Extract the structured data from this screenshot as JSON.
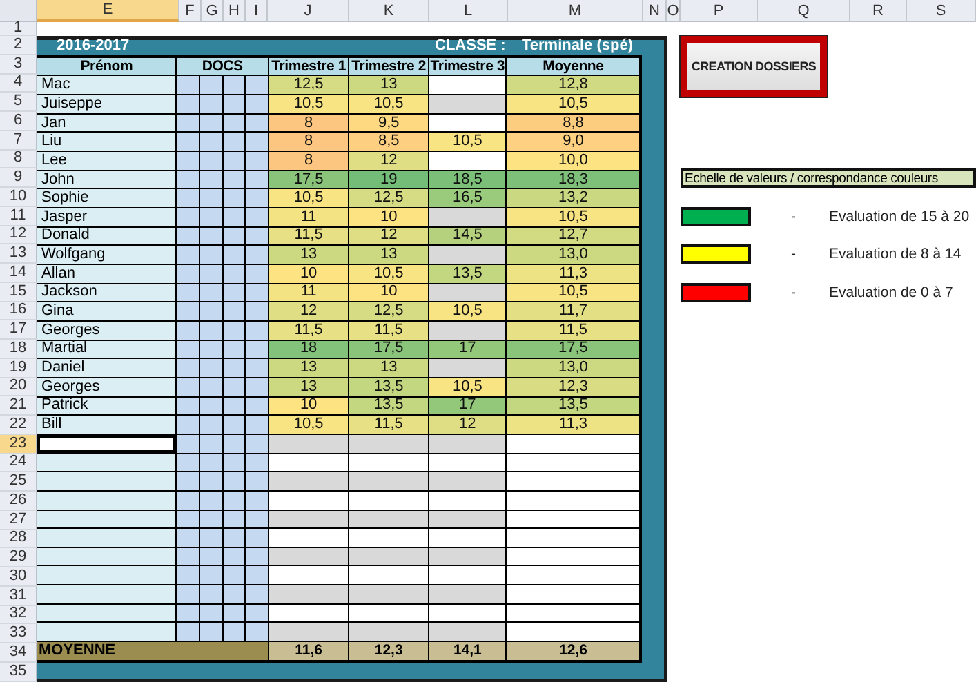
{
  "column_headers": [
    {
      "label": "E",
      "selected": true
    },
    {
      "label": "F",
      "selected": false
    },
    {
      "label": "G",
      "selected": false
    },
    {
      "label": "H",
      "selected": false
    },
    {
      "label": "I",
      "selected": false
    },
    {
      "label": "J",
      "selected": false
    },
    {
      "label": "K",
      "selected": false
    },
    {
      "label": "L",
      "selected": false
    },
    {
      "label": "M",
      "selected": false
    },
    {
      "label": "N",
      "selected": false
    },
    {
      "label": "O",
      "selected": false
    },
    {
      "label": "P",
      "selected": false
    },
    {
      "label": "Q",
      "selected": false
    },
    {
      "label": "R",
      "selected": false
    },
    {
      "label": "S",
      "selected": false
    }
  ],
  "row_numbers": [
    {
      "label": "1",
      "selected": false
    },
    {
      "label": "2",
      "selected": false
    },
    {
      "label": "3",
      "selected": false
    },
    {
      "label": "4",
      "selected": false
    },
    {
      "label": "5",
      "selected": false
    },
    {
      "label": "6",
      "selected": false
    },
    {
      "label": "7",
      "selected": false
    },
    {
      "label": "8",
      "selected": false
    },
    {
      "label": "9",
      "selected": false
    },
    {
      "label": "10",
      "selected": false
    },
    {
      "label": "11",
      "selected": false
    },
    {
      "label": "12",
      "selected": false
    },
    {
      "label": "13",
      "selected": false
    },
    {
      "label": "14",
      "selected": false
    },
    {
      "label": "15",
      "selected": false
    },
    {
      "label": "16",
      "selected": false
    },
    {
      "label": "17",
      "selected": false
    },
    {
      "label": "18",
      "selected": false
    },
    {
      "label": "19",
      "selected": false
    },
    {
      "label": "20",
      "selected": false
    },
    {
      "label": "21",
      "selected": false
    },
    {
      "label": "22",
      "selected": false
    },
    {
      "label": "23",
      "selected": true
    },
    {
      "label": "24",
      "selected": false
    },
    {
      "label": "25",
      "selected": false
    },
    {
      "label": "26",
      "selected": false
    },
    {
      "label": "27",
      "selected": false
    },
    {
      "label": "28",
      "selected": false
    },
    {
      "label": "29",
      "selected": false
    },
    {
      "label": "30",
      "selected": false
    },
    {
      "label": "31",
      "selected": false
    },
    {
      "label": "32",
      "selected": false
    },
    {
      "label": "33",
      "selected": false
    },
    {
      "label": "34",
      "selected": false
    },
    {
      "label": "35",
      "selected": false
    }
  ],
  "sheet": {
    "year": "2016-2017",
    "class_label": "CLASSE :",
    "class_value": "Terminale (spé)",
    "headers": {
      "name": "Prénom",
      "docs": "DOCS",
      "grades": [
        "Trimestre 1",
        "Trimestre 2",
        "Trimestre 3"
      ],
      "average": "Moyenne"
    },
    "students": [
      {
        "name": "Mac",
        "selected": false,
        "grades": [
          {
            "text": "12,5",
            "color": "#d5dc83"
          },
          {
            "text": "13",
            "color": "#ccd981"
          }
        ],
        "shaded": false,
        "average": {
          "text": "12,8",
          "color": "#d0da82"
        }
      },
      {
        "name": "Juiseppe",
        "selected": false,
        "grades": [
          {
            "text": "10,5",
            "color": "#f8e483"
          },
          {
            "text": "10,5",
            "color": "#f8e483"
          }
        ],
        "shaded": true,
        "average": {
          "text": "10,5",
          "color": "#f8e483"
        }
      },
      {
        "name": "Jan",
        "selected": false,
        "grades": [
          {
            "text": "8",
            "color": "#fcc680"
          },
          {
            "text": "9,5",
            "color": "#fed982"
          }
        ],
        "shaded": false,
        "average": {
          "text": "8,8",
          "color": "#fdcd7f"
        }
      },
      {
        "name": "Liu",
        "selected": false,
        "grades": [
          {
            "text": "8",
            "color": "#fcc680"
          },
          {
            "text": "8,5",
            "color": "#fdcf80"
          },
          {
            "text": "10,5",
            "color": "#f8e483"
          }
        ],
        "average": {
          "text": "9,0",
          "color": "#fdd181"
        }
      },
      {
        "name": "Lee",
        "selected": false,
        "grades": [
          {
            "text": "8",
            "color": "#fcc680"
          },
          {
            "text": "12",
            "color": "#dfde84"
          }
        ],
        "shaded": false,
        "average": {
          "text": "10,0",
          "color": "#fee383"
        }
      },
      {
        "name": "John",
        "selected": false,
        "grades": [
          {
            "text": "17,5",
            "color": "#8ac47a"
          },
          {
            "text": "19",
            "color": "#74bd78"
          },
          {
            "text": "18,5",
            "color": "#7bbf79"
          }
        ],
        "average": {
          "text": "18,3",
          "color": "#7ec079"
        }
      },
      {
        "name": "Sophie",
        "selected": false,
        "grades": [
          {
            "text": "10,5",
            "color": "#f8e483"
          },
          {
            "text": "12,5",
            "color": "#d5dc83"
          },
          {
            "text": "16,5",
            "color": "#9acb7c"
          }
        ],
        "average": {
          "text": "13,2",
          "color": "#c9d881"
        }
      },
      {
        "name": "Jasper",
        "selected": false,
        "grades": [
          {
            "text": "11",
            "color": "#f3e383"
          },
          {
            "text": "10",
            "color": "#fee383"
          }
        ],
        "shaded": true,
        "average": {
          "text": "10,5",
          "color": "#f8e483"
        }
      },
      {
        "name": "Donald",
        "selected": false,
        "grades": [
          {
            "text": "11,5",
            "color": "#e8e084"
          },
          {
            "text": "12",
            "color": "#dfde84"
          },
          {
            "text": "14,5",
            "color": "#b5d17e"
          }
        ],
        "average": {
          "text": "12,7",
          "color": "#d2da82"
        }
      },
      {
        "name": "Wolfgang",
        "selected": false,
        "grades": [
          {
            "text": "13",
            "color": "#ccd981"
          },
          {
            "text": "13",
            "color": "#ccd981"
          }
        ],
        "shaded": true,
        "average": {
          "text": "13,0",
          "color": "#ccd981"
        }
      },
      {
        "name": "Allan",
        "selected": false,
        "grades": [
          {
            "text": "10",
            "color": "#fee383"
          },
          {
            "text": "10,5",
            "color": "#f8e483"
          },
          {
            "text": "13,5",
            "color": "#c3d680"
          }
        ],
        "average": {
          "text": "11,3",
          "color": "#ede384"
        }
      },
      {
        "name": "Jackson",
        "selected": false,
        "grades": [
          {
            "text": "11",
            "color": "#f3e383"
          },
          {
            "text": "10",
            "color": "#fee383"
          }
        ],
        "shaded": true,
        "average": {
          "text": "10,5",
          "color": "#f8e483"
        }
      },
      {
        "name": "Gina",
        "selected": false,
        "grades": [
          {
            "text": "12",
            "color": "#dfde84"
          },
          {
            "text": "12,5",
            "color": "#d5dc83"
          },
          {
            "text": "10,5",
            "color": "#f8e483"
          }
        ],
        "average": {
          "text": "11,7",
          "color": "#e3df84"
        }
      },
      {
        "name": "Georges",
        "selected": false,
        "grades": [
          {
            "text": "11,5",
            "color": "#e8e084"
          },
          {
            "text": "11,5",
            "color": "#e8e084"
          }
        ],
        "shaded": true,
        "average": {
          "text": "11,5",
          "color": "#e8e084"
        }
      },
      {
        "name": "Martial",
        "selected": false,
        "grades": [
          {
            "text": "18",
            "color": "#82c27a"
          },
          {
            "text": "17,5",
            "color": "#8ac47a"
          },
          {
            "text": "17",
            "color": "#93c87b"
          }
        ],
        "average": {
          "text": "17,5",
          "color": "#8ac47a"
        }
      },
      {
        "name": "Daniel",
        "selected": false,
        "grades": [
          {
            "text": "13",
            "color": "#ccd981"
          },
          {
            "text": "13",
            "color": "#ccd981"
          }
        ],
        "shaded": true,
        "average": {
          "text": "13,0",
          "color": "#ccd981"
        }
      },
      {
        "name": "Georges",
        "selected": false,
        "grades": [
          {
            "text": "13",
            "color": "#ccd981"
          },
          {
            "text": "13,5",
            "color": "#c3d680"
          },
          {
            "text": "10,5",
            "color": "#f8e483"
          }
        ],
        "average": {
          "text": "12,3",
          "color": "#d9dc83"
        }
      },
      {
        "name": "Patrick",
        "selected": false,
        "grades": [
          {
            "text": "10",
            "color": "#fee383"
          },
          {
            "text": "13,5",
            "color": "#c3d680"
          },
          {
            "text": "17",
            "color": "#93c87b"
          }
        ],
        "average": {
          "text": "13,5",
          "color": "#c3d680"
        }
      },
      {
        "name": "Bill",
        "selected": false,
        "grades": [
          {
            "text": "10,5",
            "color": "#f8e483"
          },
          {
            "text": "11,5",
            "color": "#e8e084"
          },
          {
            "text": "12",
            "color": "#dfde84"
          }
        ],
        "average": {
          "text": "11,3",
          "color": "#ede384"
        }
      }
    ],
    "blank_rows": [
      {
        "selected": true,
        "shaded": true
      },
      {
        "selected": false,
        "shaded": false
      },
      {
        "selected": false,
        "shaded": true
      },
      {
        "selected": false,
        "shaded": false
      },
      {
        "selected": false,
        "shaded": true
      },
      {
        "selected": false,
        "shaded": false
      },
      {
        "selected": false,
        "shaded": true
      },
      {
        "selected": false,
        "shaded": false
      },
      {
        "selected": false,
        "shaded": true
      },
      {
        "selected": false,
        "shaded": false
      },
      {
        "selected": false,
        "shaded": true
      }
    ],
    "footer": {
      "label": "MOYENNE",
      "values": [
        "11,6",
        "12,3",
        "14,1",
        "12,6"
      ]
    }
  },
  "action_button": {
    "label": "CREATION DOSSIERS"
  },
  "legend": {
    "title": "Echelle de valeurs / correspondance couleurs",
    "items": [
      {
        "color": "#00b050",
        "dash": "-",
        "text": "Evaluation de 15 à 20"
      },
      {
        "color": "#ffff00",
        "dash": "-",
        "text": "Evaluation de 8 à 14"
      },
      {
        "color": "#ff0000",
        "dash": "-",
        "text": "Evaluation de 0 à 7"
      }
    ]
  }
}
